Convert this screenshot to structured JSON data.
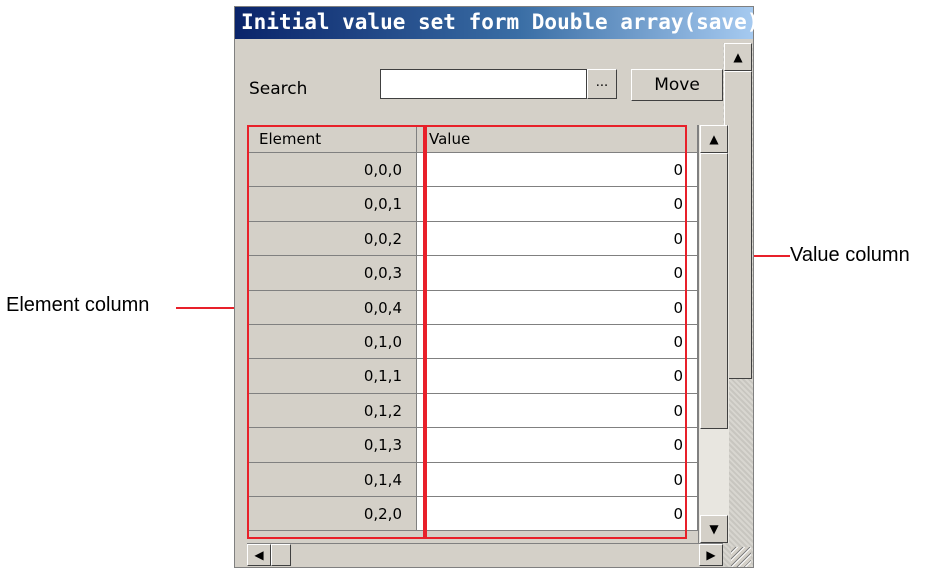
{
  "window": {
    "title": "Initial value set form Double array(save)"
  },
  "search": {
    "label": "Search",
    "value": "",
    "browse_label": "...",
    "move_label": "Move"
  },
  "grid": {
    "columns": [
      "Element",
      "Value"
    ],
    "rows": [
      {
        "element": "0,0,0",
        "value": "0"
      },
      {
        "element": "0,0,1",
        "value": "0"
      },
      {
        "element": "0,0,2",
        "value": "0"
      },
      {
        "element": "0,0,3",
        "value": "0"
      },
      {
        "element": "0,0,4",
        "value": "0"
      },
      {
        "element": "0,1,0",
        "value": "0"
      },
      {
        "element": "0,1,1",
        "value": "0"
      },
      {
        "element": "0,1,2",
        "value": "0"
      },
      {
        "element": "0,1,3",
        "value": "0"
      },
      {
        "element": "0,1,4",
        "value": "0"
      },
      {
        "element": "0,2,0",
        "value": "0"
      }
    ]
  },
  "annotations": {
    "element_column": "Element column",
    "value_column": "Value column"
  },
  "icons": {
    "scroll_up": "up-arrow-icon",
    "scroll_down": "down-arrow-icon",
    "scroll_left": "left-arrow-icon",
    "scroll_right": "right-arrow-icon",
    "resize": "resize-grip-icon"
  },
  "colors": {
    "annotation": "#e8202a",
    "titlebar": "#0a246a"
  }
}
